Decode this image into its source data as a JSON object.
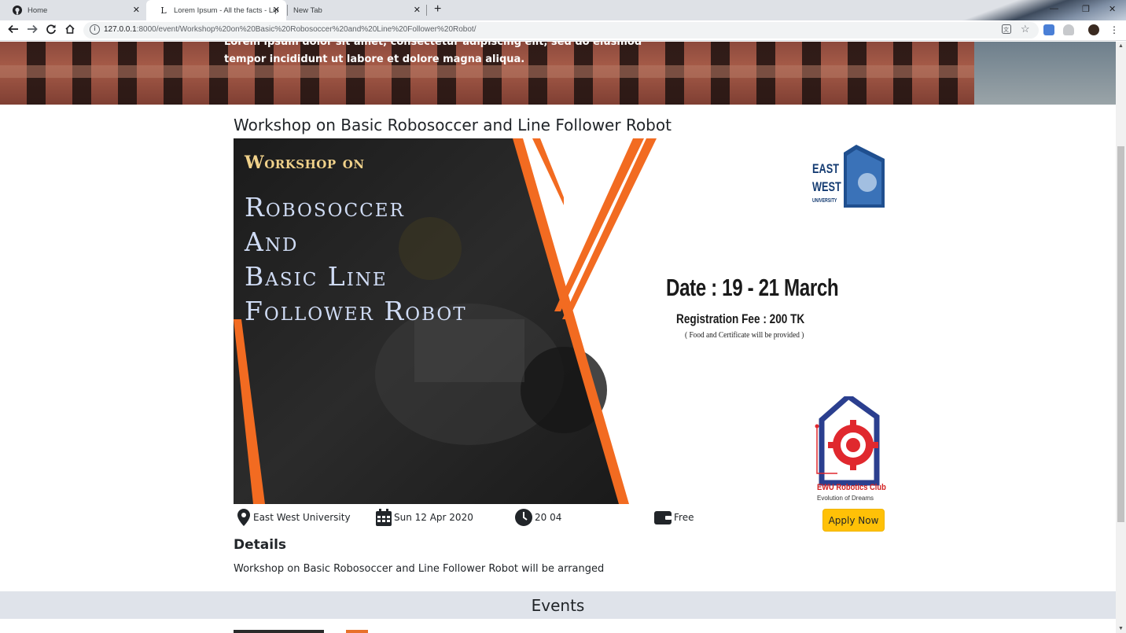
{
  "browser": {
    "tabs": [
      {
        "title": "Home",
        "icon": "github-icon"
      },
      {
        "title": "Lorem Ipsum - All the facts - Lip",
        "icon": "lipsum-icon"
      },
      {
        "title": "New Tab",
        "icon": ""
      }
    ],
    "new_tab_label": "+",
    "url": {
      "host": "127.0.0.1",
      "path": ":8000/event/Workshop%20on%20Basic%20Robosoccer%20and%20Line%20Follower%20Robot/"
    }
  },
  "hero": {
    "line1": "Lorem ipsum dolor sit amet, consectetur adipiscing elit, sed do eiusmod",
    "line2": "tempor incididunt ut labore et dolore magna aliqua."
  },
  "event": {
    "title": "Workshop on Basic Robosoccer and Line Follower Robot",
    "poster": {
      "kicker": "Workshop on",
      "lines": [
        "Robosoccer",
        "And",
        "Basic Line",
        "Follower Robot"
      ],
      "date": "Date : 19 - 21 March",
      "fee": "Registration Fee : 200 TK",
      "note": "( Food and Certificate will be provided )",
      "ewu_logo": {
        "line1": "EAST",
        "line2": "WEST",
        "line3": "UNIVERSITY"
      },
      "club_name": "EWU Robotics Club",
      "club_tagline": "Evolution of Dreams"
    },
    "location": "East West University",
    "date": "Sun 12 Apr 2020",
    "time": "20 04",
    "price": "Free",
    "apply_label": "Apply Now",
    "details_heading": "Details",
    "details_text": "Workshop on Basic Robosoccer and Line Follower Robot will be arranged"
  },
  "events_section": {
    "heading": "Events"
  },
  "colors": {
    "accent": "#ffc107",
    "orange_stripe": "#f26b21",
    "events_band": "#dfe3ea"
  }
}
